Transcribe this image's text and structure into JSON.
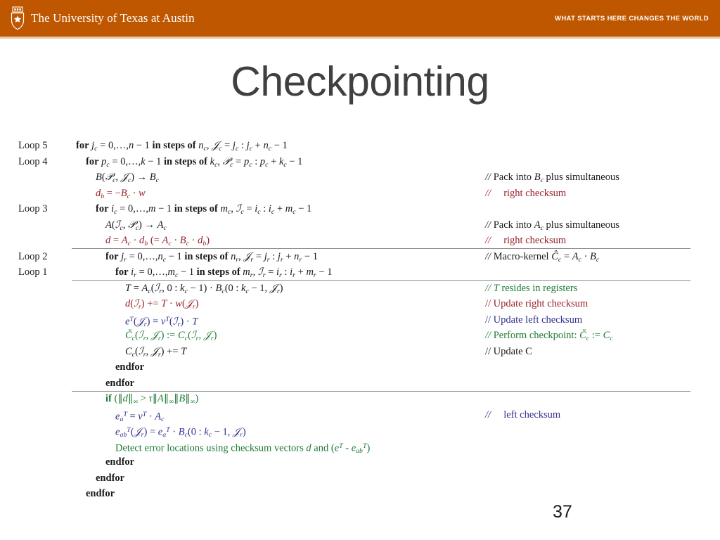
{
  "header": {
    "brand_color": "#bf5700",
    "wordmark": "The University of Texas at Austin",
    "tagline": "WHAT STARTS HERE CHANGES THE WORLD",
    "logo_icon": "ut-shield-icon"
  },
  "slide": {
    "title": "Checkpointing",
    "page_number": "37"
  },
  "colors": {
    "black": "#1a1a1a",
    "red": "#99202a",
    "blue": "#332f8e",
    "green": "#1f7a34",
    "rule": "#8a8a8a",
    "title": "#404040"
  },
  "algorithm": {
    "loop_labels": {
      "loop5": "Loop 5",
      "loop4": "Loop 4",
      "loop3": "Loop 3",
      "loop2": "Loop 2",
      "loop1": "Loop 1"
    },
    "lines": [
      {
        "id": "loop5-for",
        "loop": "Loop 5",
        "indent": 0,
        "color": "black",
        "code_text": "for j_c = 0, ..., n - 1 in steps of n_c, J_c = j_c : j_c + n_c - 1",
        "comment_text": ""
      },
      {
        "id": "loop4-for",
        "loop": "Loop 4",
        "indent": 1,
        "color": "black",
        "code_text": "for p_c = 0, ..., k - 1 in steps of k_c, P_c = p_c : p_c + k_c - 1",
        "comment_text": ""
      },
      {
        "id": "pack-b",
        "loop": "",
        "indent": 2,
        "color": "black",
        "code_text": "B(P_c, J_c) -> B_c",
        "comment_text": "// Pack into B_c plus simultaneous"
      },
      {
        "id": "db-assign",
        "loop": "",
        "indent": 2,
        "color": "red",
        "code_text": "d_b = -B_c . w",
        "comment_text": "//    right checksum",
        "comment_prefix": "//",
        "comment_body": "right checksum",
        "comment_color": "red"
      },
      {
        "id": "loop3-for",
        "loop": "Loop 3",
        "indent": 2,
        "color": "black",
        "code_text": "for i_c = 0, ..., m - 1 in steps of m_c, I_c = i_c : i_c + m_c - 1",
        "comment_text": ""
      },
      {
        "id": "pack-a",
        "loop": "",
        "indent": 3,
        "color": "black",
        "code_text": "A(I_c, P_c) -> A_c",
        "comment_text": "// Pack into A_c plus simultaneous"
      },
      {
        "id": "d-assign",
        "loop": "",
        "indent": 3,
        "color": "red",
        "code_text": "d = A_c . d_b (= A_c . B_c . d_b)",
        "comment_prefix": "//",
        "comment_body": "right checksum",
        "comment_color": "red"
      },
      {
        "id": "loop2-for",
        "loop": "Loop 2",
        "indent": 3,
        "color": "black",
        "code_text": "for j_r = 0, ..., n_c - 1 in steps of n_r, J_r = j_r : j_r + n_r - 1",
        "comment_text": "// Macro-kernel Ĉ_c = A_c . B_c"
      },
      {
        "id": "loop1-for",
        "loop": "Loop 1",
        "indent": 4,
        "color": "black",
        "code_text": "for i_r = 0, ..., m_c - 1 in steps of m_r, I_r = i_r : i_r + m_r - 1",
        "comment_text": ""
      },
      {
        "id": "t-assign",
        "loop": "",
        "indent": 5,
        "color": "black",
        "code_text": "T = A_c(I_r, 0 : k_c - 1) . B_c(0 : k_c - 1, J_r)",
        "comment_text": "// T resides in registers",
        "comment_color": "green"
      },
      {
        "id": "d-update",
        "loop": "",
        "indent": 5,
        "color": "red",
        "code_text": "d(I_r) += T . w(J_r)",
        "comment_text": "// Update right checksum",
        "comment_color": "red"
      },
      {
        "id": "e-update",
        "loop": "",
        "indent": 5,
        "color": "blue",
        "code_text": "e^T(J_r) = v^T(I_r) . T",
        "comment_text": "// Update left checksum",
        "comment_color": "blue"
      },
      {
        "id": "checkpoint",
        "loop": "",
        "indent": 5,
        "color": "green",
        "code_text": "Č_c(I_r, J_r) := C_c(I_r, J_r)",
        "comment_text": "// Perform checkpoint: Č_c := C_c",
        "comment_color": "green"
      },
      {
        "id": "c-update",
        "loop": "",
        "indent": 5,
        "color": "black",
        "code_text": "C_c(I_r, J_r) += T",
        "comment_text": "// Update C",
        "comment_color": "black"
      },
      {
        "id": "endfor-1",
        "loop": "",
        "indent": 4,
        "color": "black",
        "code_text": "endfor",
        "comment_text": ""
      },
      {
        "id": "endfor-2",
        "loop": "",
        "indent": 3,
        "color": "black",
        "code_text": "endfor",
        "comment_text": ""
      },
      {
        "id": "if-test",
        "loop": "",
        "indent": 3,
        "color": "green",
        "code_text": "if (||d||∞ > τ||A||∞||B||∞)",
        "comment_text": ""
      },
      {
        "id": "ea-assign",
        "loop": "",
        "indent": 4,
        "color": "blue",
        "code_text": "e_a^T = v^T . A_c",
        "comment_prefix": "//",
        "comment_body": "left checksum",
        "comment_color": "blue"
      },
      {
        "id": "eab-assign",
        "loop": "",
        "indent": 4,
        "color": "blue",
        "code_text": "e_ab^T(J_r) = e_a^T . B_c(0 : k_c - 1, J_r)",
        "comment_text": ""
      },
      {
        "id": "detect",
        "loop": "",
        "indent": 4,
        "color": "green",
        "code_text": "Detect error locations using checksum vectors d and (e^T - e_ab^T)",
        "comment_text": ""
      },
      {
        "id": "endfor-3",
        "loop": "",
        "indent": 3,
        "color": "black",
        "code_text": "endfor",
        "comment_text": ""
      },
      {
        "id": "endfor-4",
        "loop": "",
        "indent": 2,
        "color": "black",
        "code_text": "endfor",
        "comment_text": ""
      },
      {
        "id": "endfor-5",
        "loop": "",
        "indent": 1,
        "color": "black",
        "code_text": "endfor",
        "comment_text": ""
      }
    ],
    "comment_labels": {
      "pack_b": "// Pack into B",
      "pack_b_sub": "c",
      "pack_b_tail": " plus simultaneous",
      "pack_a": "// Pack into A",
      "pack_a_tail": " plus simultaneous",
      "right_checksum": "right checksum",
      "left_checksum": "left checksum",
      "macro_kernel": "// Macro-kernel",
      "t_registers": "// T resides in registers",
      "update_right": "// Update right checksum",
      "update_left": "// Update left checksum",
      "perform_checkpoint": "// Perform checkpoint:",
      "update_c": "// Update C",
      "slashes": "//"
    },
    "keywords": {
      "for": "for",
      "endfor": "endfor",
      "if": "if",
      "in_steps_of": "in steps of",
      "detect": "Detect error locations using checksum vectors",
      "and": "and"
    }
  }
}
